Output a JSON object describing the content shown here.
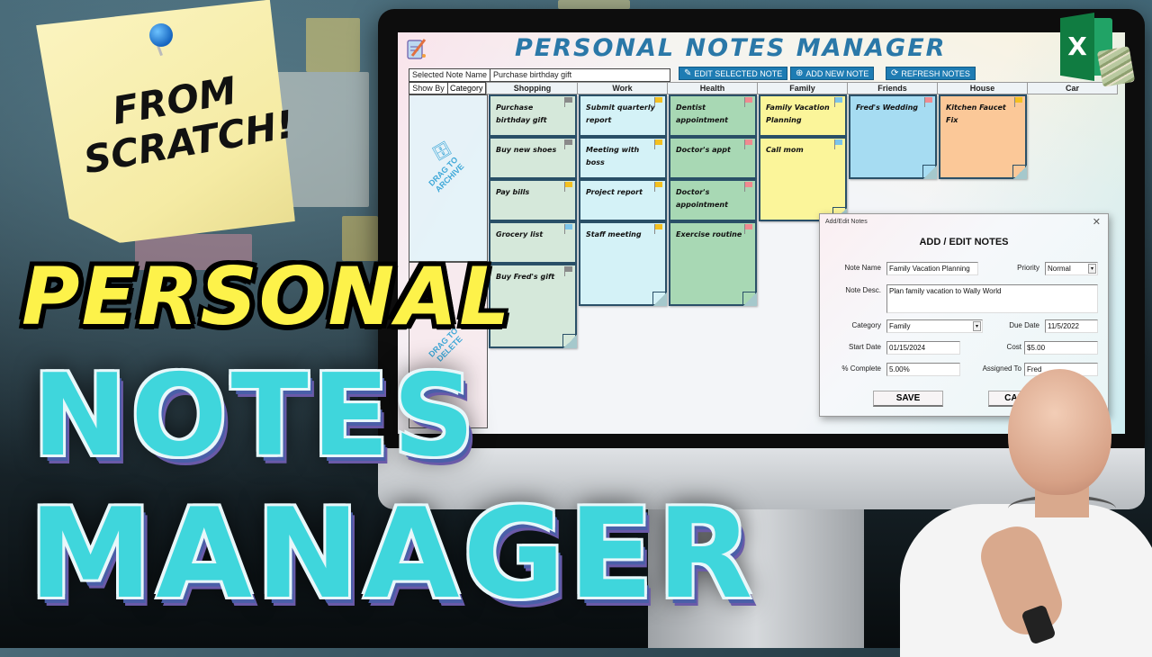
{
  "thumbnail": {
    "sticky_note": "FROM SCRATCH!",
    "headline_line1": "PERSONAL",
    "headline_line2": "NOTES",
    "headline_line3": "MANAGER"
  },
  "app": {
    "title": "PERSONAL NOTES MANAGER",
    "selected_note_label": "Selected Note Name",
    "selected_note_value": "Purchase birthday gift",
    "show_by_label": "Show By",
    "show_by_value": "Category",
    "buttons": {
      "edit": "EDIT SELECTED NOTE",
      "add": "ADD NEW NOTE",
      "refresh": "REFRESH NOTES"
    },
    "archive_zone": "DRAG TO ARCHIVE",
    "delete_zone": "DRAG TO DELETE",
    "categories": [
      "Shopping",
      "Work",
      "Health",
      "Family",
      "Friends",
      "House",
      "Car"
    ],
    "notes": {
      "shopping": [
        {
          "text": "Purchase birthday gift",
          "flag": "#8a8a8a"
        },
        {
          "text": "Buy new shoes",
          "flag": "#8a8a8a"
        },
        {
          "text": "Pay bills",
          "flag": "#f4c020"
        },
        {
          "text": "Grocery list",
          "flag": "#7cc4ea"
        },
        {
          "text": "Buy Fred's gift",
          "flag": "#8a8a8a"
        }
      ],
      "work": [
        {
          "text": "Submit quarterly report",
          "flag": "#f4c020"
        },
        {
          "text": "Meeting with boss",
          "flag": "#f4c020"
        },
        {
          "text": "Project report",
          "flag": "#f4c020"
        },
        {
          "text": "Staff meeting",
          "flag": "#f4c020"
        }
      ],
      "health": [
        {
          "text": "Dentist appointment",
          "flag": "#f08a90"
        },
        {
          "text": "Doctor's appt",
          "flag": "#f08a90"
        },
        {
          "text": "Doctor's appointment",
          "flag": "#f08a90"
        },
        {
          "text": "Exercise routine",
          "flag": "#f08a90"
        }
      ],
      "family": [
        {
          "text": "Family Vacation Planning",
          "flag": "#7cc4ea"
        },
        {
          "text": "Call mom",
          "flag": "#7cc4ea"
        }
      ],
      "friends": [
        {
          "text": "Fred's Wedding",
          "flag": "#f08a90"
        }
      ],
      "house": [
        {
          "text": "Kitchen Faucet Fix",
          "flag": "#f4c020"
        }
      ]
    },
    "colors": {
      "shopping": "#d5e8da",
      "work": "#d4f2f7",
      "health": "#a8d8b4",
      "family": "#fbf59a",
      "friends": "#a6dcf2",
      "house": "#fbc898",
      "accent": "#1e7cb3",
      "title": "#2a78a8"
    }
  },
  "dialog": {
    "window_title": "Add/Edit Notes",
    "heading": "ADD / EDIT NOTES",
    "labels": {
      "note_name": "Note Name",
      "priority": "Priority",
      "note_desc": "Note Desc.",
      "category": "Category",
      "due_date": "Due Date",
      "start_date": "Start Date",
      "cost": "Cost",
      "pct_complete": "% Complete",
      "assigned_to": "Assigned To"
    },
    "values": {
      "note_name": "Family Vacation Planning",
      "priority": "Normal",
      "note_desc": "Plan family vacation to Wally World",
      "category": "Family",
      "due_date": "11/5/2022",
      "start_date": "01/15/2024",
      "cost": "$5.00",
      "pct_complete": "5.00%",
      "assigned_to": "Fred"
    },
    "save": "SAVE",
    "cancel": "CANCEL"
  },
  "excel_logo": "X"
}
